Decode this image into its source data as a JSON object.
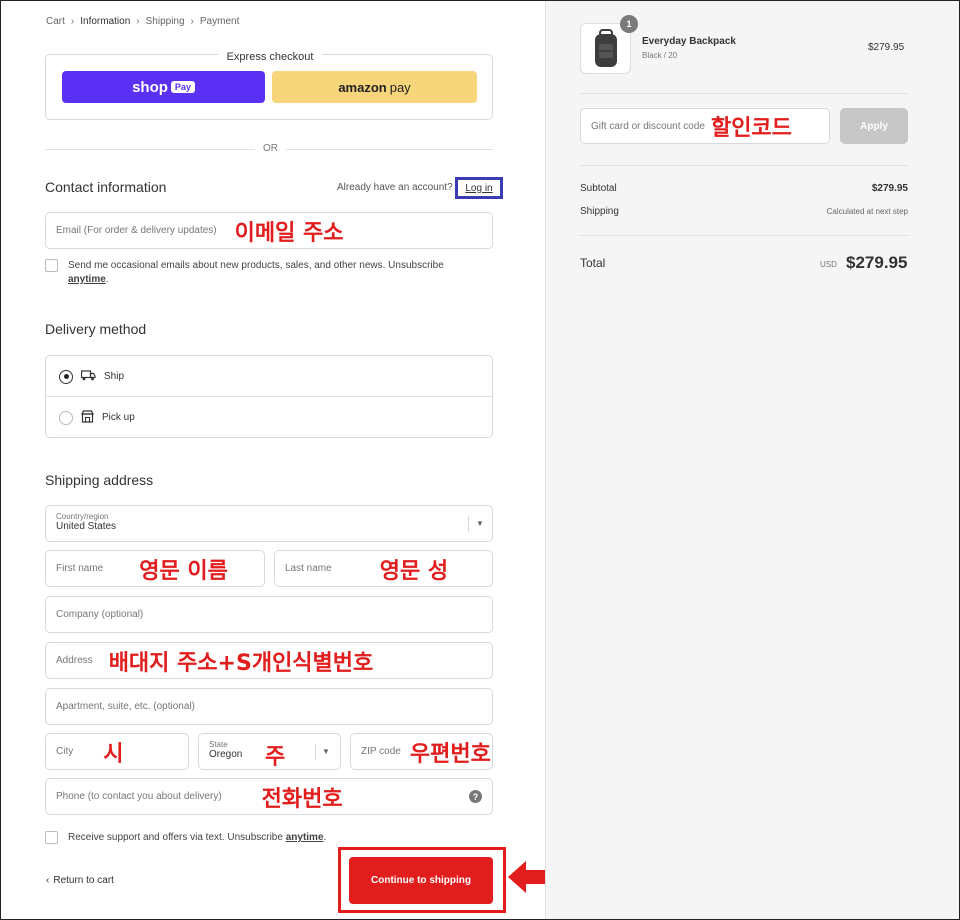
{
  "breadcrumb": {
    "cart": "Cart",
    "information": "Information",
    "shipping": "Shipping",
    "payment": "Payment"
  },
  "express": {
    "title": "Express checkout",
    "shoppay_label": "shop",
    "shoppay_pay": "Pay",
    "amazonpay_bold": "amazon",
    "amazonpay_rest": "pay",
    "or": "OR"
  },
  "contact": {
    "title": "Contact information",
    "account_text": "Already have an account?",
    "login": "Log in",
    "email_placeholder": "Email (For order & delivery updates)",
    "email_annotation": "이메일 주소",
    "newsletter_text": "Send me occasional emails about new products, sales, and other news. Unsubscribe",
    "newsletter_link": "anytime",
    "newsletter_end": "."
  },
  "delivery": {
    "title": "Delivery method",
    "ship": "Ship",
    "pickup": "Pick up",
    "selected": "Ship"
  },
  "shipping": {
    "title": "Shipping address",
    "country_label": "Country/region",
    "country_value": "United States",
    "first_name": "First name",
    "first_name_annotation": "영문 이름",
    "last_name": "Last name",
    "last_name_annotation": "영문 성",
    "company": "Company (optional)",
    "address": "Address",
    "address_annotation": "배대지 주소+S개인식별번호",
    "apartment": "Apartment, suite, etc. (optional)",
    "city": "City",
    "city_annotation": "시",
    "state_label": "State",
    "state_value": "Oregon",
    "state_annotation": "주",
    "zip": "ZIP code",
    "zip_annotation": "우편번호",
    "phone": "Phone (to contact you about delivery)",
    "phone_annotation": "전화번호",
    "sms_text": "Receive support and offers via text. Unsubscribe",
    "sms_link": "anytime",
    "sms_end": "."
  },
  "footer": {
    "return": "Return to cart",
    "continue": "Continue to shipping"
  },
  "summary": {
    "quantity": "1",
    "product_name": "Everyday Backpack",
    "product_variant": "Black / 20",
    "product_price": "$279.95",
    "gift_placeholder": "Gift card or discount code",
    "gift_annotation": "할인코드",
    "apply": "Apply",
    "subtotal_label": "Subtotal",
    "subtotal_value": "$279.95",
    "shipping_label": "Shipping",
    "shipping_value": "Calculated at next step",
    "total_label": "Total",
    "currency": "USD",
    "total_value": "$279.95"
  },
  "colors": {
    "shoppay": "#5a31f4",
    "amazonpay": "#f7d57a",
    "annotation": "#e21d1d",
    "login_highlight": "#3b3bb5"
  },
  "icons": [
    "chevron-right-icon",
    "truck-icon",
    "store-icon",
    "chevron-down-icon",
    "help-icon",
    "chevron-left-icon",
    "arrow-left-icon",
    "backpack-icon"
  ]
}
